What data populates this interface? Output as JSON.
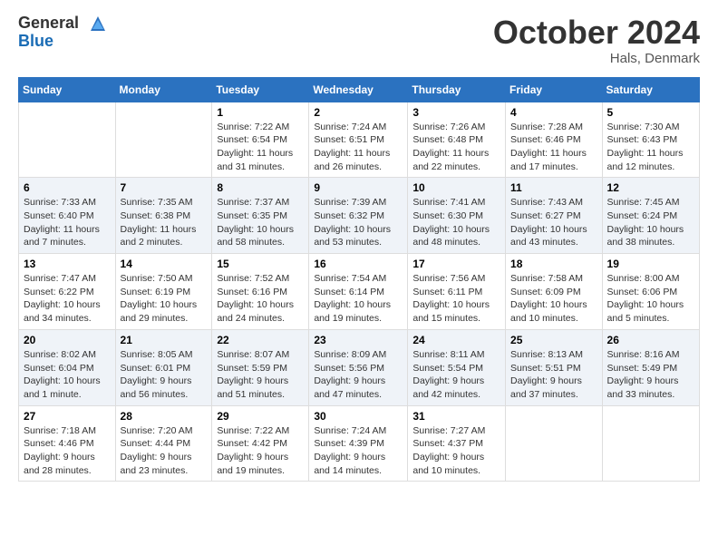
{
  "header": {
    "logo_line1": "General",
    "logo_line2": "Blue",
    "month_title": "October 2024",
    "location": "Hals, Denmark"
  },
  "weekdays": [
    "Sunday",
    "Monday",
    "Tuesday",
    "Wednesday",
    "Thursday",
    "Friday",
    "Saturday"
  ],
  "weeks": [
    [
      {
        "day": "",
        "info": ""
      },
      {
        "day": "",
        "info": ""
      },
      {
        "day": "1",
        "info": "Sunrise: 7:22 AM\nSunset: 6:54 PM\nDaylight: 11 hours and 31 minutes."
      },
      {
        "day": "2",
        "info": "Sunrise: 7:24 AM\nSunset: 6:51 PM\nDaylight: 11 hours and 26 minutes."
      },
      {
        "day": "3",
        "info": "Sunrise: 7:26 AM\nSunset: 6:48 PM\nDaylight: 11 hours and 22 minutes."
      },
      {
        "day": "4",
        "info": "Sunrise: 7:28 AM\nSunset: 6:46 PM\nDaylight: 11 hours and 17 minutes."
      },
      {
        "day": "5",
        "info": "Sunrise: 7:30 AM\nSunset: 6:43 PM\nDaylight: 11 hours and 12 minutes."
      }
    ],
    [
      {
        "day": "6",
        "info": "Sunrise: 7:33 AM\nSunset: 6:40 PM\nDaylight: 11 hours and 7 minutes."
      },
      {
        "day": "7",
        "info": "Sunrise: 7:35 AM\nSunset: 6:38 PM\nDaylight: 11 hours and 2 minutes."
      },
      {
        "day": "8",
        "info": "Sunrise: 7:37 AM\nSunset: 6:35 PM\nDaylight: 10 hours and 58 minutes."
      },
      {
        "day": "9",
        "info": "Sunrise: 7:39 AM\nSunset: 6:32 PM\nDaylight: 10 hours and 53 minutes."
      },
      {
        "day": "10",
        "info": "Sunrise: 7:41 AM\nSunset: 6:30 PM\nDaylight: 10 hours and 48 minutes."
      },
      {
        "day": "11",
        "info": "Sunrise: 7:43 AM\nSunset: 6:27 PM\nDaylight: 10 hours and 43 minutes."
      },
      {
        "day": "12",
        "info": "Sunrise: 7:45 AM\nSunset: 6:24 PM\nDaylight: 10 hours and 38 minutes."
      }
    ],
    [
      {
        "day": "13",
        "info": "Sunrise: 7:47 AM\nSunset: 6:22 PM\nDaylight: 10 hours and 34 minutes."
      },
      {
        "day": "14",
        "info": "Sunrise: 7:50 AM\nSunset: 6:19 PM\nDaylight: 10 hours and 29 minutes."
      },
      {
        "day": "15",
        "info": "Sunrise: 7:52 AM\nSunset: 6:16 PM\nDaylight: 10 hours and 24 minutes."
      },
      {
        "day": "16",
        "info": "Sunrise: 7:54 AM\nSunset: 6:14 PM\nDaylight: 10 hours and 19 minutes."
      },
      {
        "day": "17",
        "info": "Sunrise: 7:56 AM\nSunset: 6:11 PM\nDaylight: 10 hours and 15 minutes."
      },
      {
        "day": "18",
        "info": "Sunrise: 7:58 AM\nSunset: 6:09 PM\nDaylight: 10 hours and 10 minutes."
      },
      {
        "day": "19",
        "info": "Sunrise: 8:00 AM\nSunset: 6:06 PM\nDaylight: 10 hours and 5 minutes."
      }
    ],
    [
      {
        "day": "20",
        "info": "Sunrise: 8:02 AM\nSunset: 6:04 PM\nDaylight: 10 hours and 1 minute."
      },
      {
        "day": "21",
        "info": "Sunrise: 8:05 AM\nSunset: 6:01 PM\nDaylight: 9 hours and 56 minutes."
      },
      {
        "day": "22",
        "info": "Sunrise: 8:07 AM\nSunset: 5:59 PM\nDaylight: 9 hours and 51 minutes."
      },
      {
        "day": "23",
        "info": "Sunrise: 8:09 AM\nSunset: 5:56 PM\nDaylight: 9 hours and 47 minutes."
      },
      {
        "day": "24",
        "info": "Sunrise: 8:11 AM\nSunset: 5:54 PM\nDaylight: 9 hours and 42 minutes."
      },
      {
        "day": "25",
        "info": "Sunrise: 8:13 AM\nSunset: 5:51 PM\nDaylight: 9 hours and 37 minutes."
      },
      {
        "day": "26",
        "info": "Sunrise: 8:16 AM\nSunset: 5:49 PM\nDaylight: 9 hours and 33 minutes."
      }
    ],
    [
      {
        "day": "27",
        "info": "Sunrise: 7:18 AM\nSunset: 4:46 PM\nDaylight: 9 hours and 28 minutes."
      },
      {
        "day": "28",
        "info": "Sunrise: 7:20 AM\nSunset: 4:44 PM\nDaylight: 9 hours and 23 minutes."
      },
      {
        "day": "29",
        "info": "Sunrise: 7:22 AM\nSunset: 4:42 PM\nDaylight: 9 hours and 19 minutes."
      },
      {
        "day": "30",
        "info": "Sunrise: 7:24 AM\nSunset: 4:39 PM\nDaylight: 9 hours and 14 minutes."
      },
      {
        "day": "31",
        "info": "Sunrise: 7:27 AM\nSunset: 4:37 PM\nDaylight: 9 hours and 10 minutes."
      },
      {
        "day": "",
        "info": ""
      },
      {
        "day": "",
        "info": ""
      }
    ]
  ]
}
